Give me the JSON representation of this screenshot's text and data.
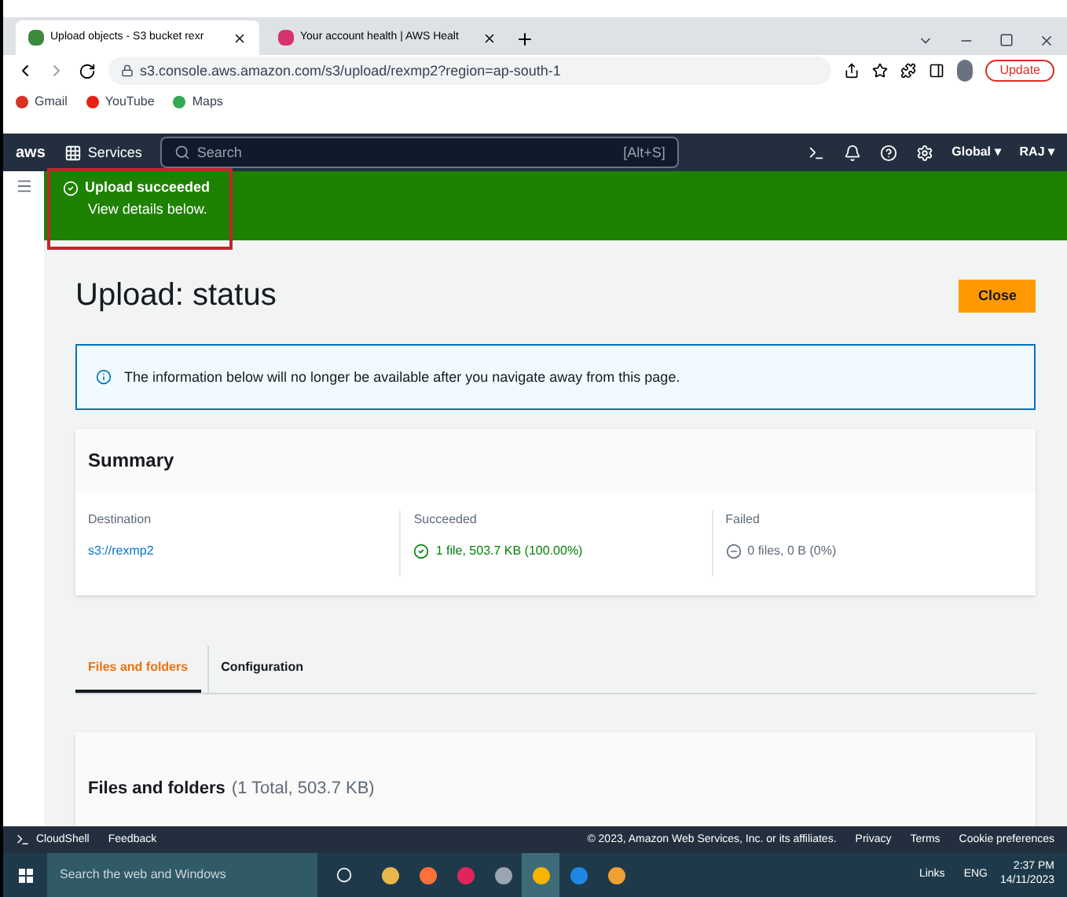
{
  "browser_tabs": [
    {
      "title": "Upload objects - S3 bucket rexr",
      "selected": true,
      "color": "#3b8a3e"
    },
    {
      "title": "Your account health | AWS Healt",
      "selected": false,
      "color": "#d6336c"
    }
  ],
  "address_bar": {
    "url": "s3.console.aws.amazon.com/s3/upload/rexmp2?region=ap-south-1",
    "update_button": "Update"
  },
  "bookmarks": [
    {
      "label": "Gmail",
      "color": "#d93025"
    },
    {
      "label": "YouTube",
      "color": "#e62117"
    },
    {
      "label": "Maps",
      "color": "#34a853"
    }
  ],
  "aws_nav": {
    "logo": "aws",
    "services": "Services",
    "search_placeholder": "Search",
    "shortcut": "[Alt+S]",
    "region": "Global ▾",
    "user": "RAJ ▾"
  },
  "flash": {
    "title": "Upload succeeded",
    "message": "View details below."
  },
  "page_title": "Upload: status",
  "close_button": "Close",
  "info_alert": "The information below will no longer be available after you navigate away from this page.",
  "summary": {
    "title": "Summary",
    "columns": [
      {
        "kind": "link",
        "label": "Destination",
        "value": "s3://rexmp2"
      },
      {
        "kind": "success",
        "label": "Succeeded",
        "value": "1 file, 503.7 KB (100.00%)"
      },
      {
        "kind": "failed",
        "label": "Failed",
        "value": "0 files, 0 B (0%)"
      }
    ]
  },
  "tabs": [
    {
      "label": "Files and folders",
      "selected": true
    },
    {
      "label": "Configuration",
      "selected": false
    }
  ],
  "files_section": {
    "title": "Files and folders",
    "count": "(1 Total, 503.7 KB)"
  },
  "footer": {
    "cloudshell": "CloudShell",
    "feedback": "Feedback",
    "copyright": "© 2023, Amazon Web Services, Inc. or its affiliates.",
    "links": [
      "Privacy",
      "Terms",
      "Cookie preferences"
    ]
  },
  "taskbar": {
    "search_placeholder": "Search the web and Windows",
    "apps": [
      {
        "selected": false,
        "color": "#e8b64a"
      },
      {
        "selected": false,
        "color": "#ff7139"
      },
      {
        "selected": false,
        "color": "#e0245e"
      },
      {
        "selected": false,
        "color": "#9aa5b1"
      },
      {
        "selected": true,
        "color": "#f4b400"
      },
      {
        "selected": false,
        "color": "#1e88e5"
      },
      {
        "selected": false,
        "color": "#f0a030"
      }
    ],
    "tray_links": "Links",
    "language": "ENG",
    "time": "2:37 PM",
    "date": "14/11/2023"
  }
}
